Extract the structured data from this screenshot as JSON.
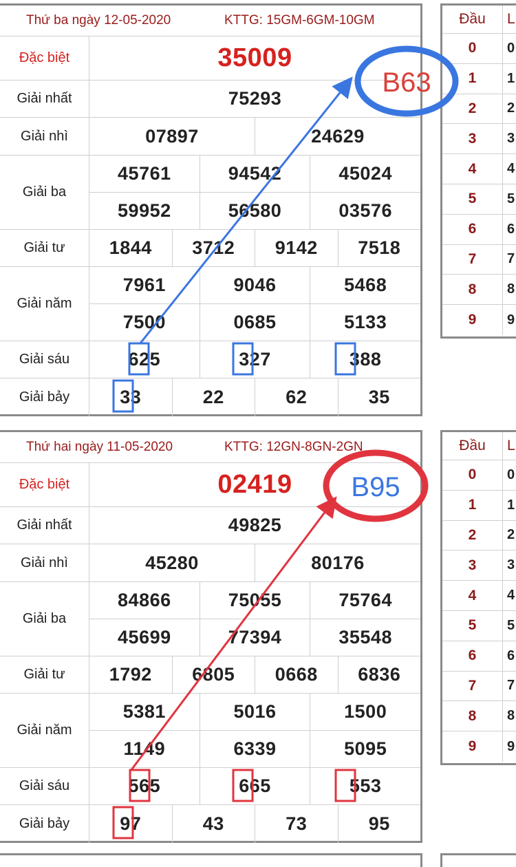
{
  "boards": [
    {
      "date": "Thứ ba ngày 12-05-2020",
      "kttg": "KTTG: 15GM-6GM-10GM",
      "labels": {
        "special": "Đặc biệt",
        "first": "Giải nhất",
        "second": "Giải nhì",
        "third": "Giải ba",
        "fourth": "Giải tư",
        "fifth": "Giải năm",
        "sixth": "Giải sáu",
        "seventh": "Giải bảy"
      },
      "special": "35009",
      "first": "75293",
      "second": [
        "07897",
        "24629"
      ],
      "third": [
        [
          "45761",
          "94542",
          "45024"
        ],
        [
          "59952",
          "56580",
          "03576"
        ]
      ],
      "fourth": [
        "1844",
        "3712",
        "9142",
        "7518"
      ],
      "fifth": [
        [
          "7961",
          "9046",
          "5468"
        ],
        [
          "7500",
          "0685",
          "5133"
        ]
      ],
      "sixth": [
        "625",
        "327",
        "388"
      ],
      "seventh": [
        "33",
        "22",
        "62",
        "35"
      ],
      "annotation": {
        "text": "B63",
        "color": "#3a76e0",
        "text_color": "#d9403a"
      }
    },
    {
      "date": "Thứ hai ngày 11-05-2020",
      "kttg": "KTTG: 12GN-8GN-2GN",
      "labels": {
        "special": "Đặc biệt",
        "first": "Giải nhất",
        "second": "Giải nhì",
        "third": "Giải ba",
        "fourth": "Giải tư",
        "fifth": "Giải năm",
        "sixth": "Giải sáu",
        "seventh": "Giải bảy"
      },
      "special": "02419",
      "first": "49825",
      "second": [
        "45280",
        "80176"
      ],
      "third": [
        [
          "84866",
          "75055",
          "75764"
        ],
        [
          "45699",
          "77394",
          "35548"
        ]
      ],
      "fourth": [
        "1792",
        "6805",
        "0668",
        "6836"
      ],
      "fifth": [
        [
          "5381",
          "5016",
          "1500"
        ],
        [
          "1149",
          "6339",
          "5095"
        ]
      ],
      "sixth": [
        "565",
        "665",
        "553"
      ],
      "seventh": [
        "97",
        "43",
        "73",
        "95"
      ],
      "annotation": {
        "text": "B95",
        "color": "#e0353f",
        "text_color": "#3a76e0"
      }
    }
  ],
  "heads": [
    {
      "header": [
        "Đầu",
        "L"
      ],
      "rows": [
        [
          "0",
          "0"
        ],
        [
          "1",
          "1"
        ],
        [
          "2",
          "2"
        ],
        [
          "3",
          "3"
        ],
        [
          "4",
          "4"
        ],
        [
          "5",
          "5"
        ],
        [
          "6",
          "6"
        ],
        [
          "7",
          "7"
        ],
        [
          "8",
          "8"
        ],
        [
          "9",
          "9"
        ]
      ]
    },
    {
      "header": [
        "Đầu",
        "L"
      ],
      "rows": [
        [
          "0",
          "0"
        ],
        [
          "1",
          "1"
        ],
        [
          "2",
          "2"
        ],
        [
          "3",
          "3"
        ],
        [
          "4",
          "4"
        ],
        [
          "5",
          "5"
        ],
        [
          "6",
          "6"
        ],
        [
          "7",
          "7"
        ],
        [
          "8",
          "8"
        ],
        [
          "9",
          "9"
        ]
      ]
    }
  ]
}
